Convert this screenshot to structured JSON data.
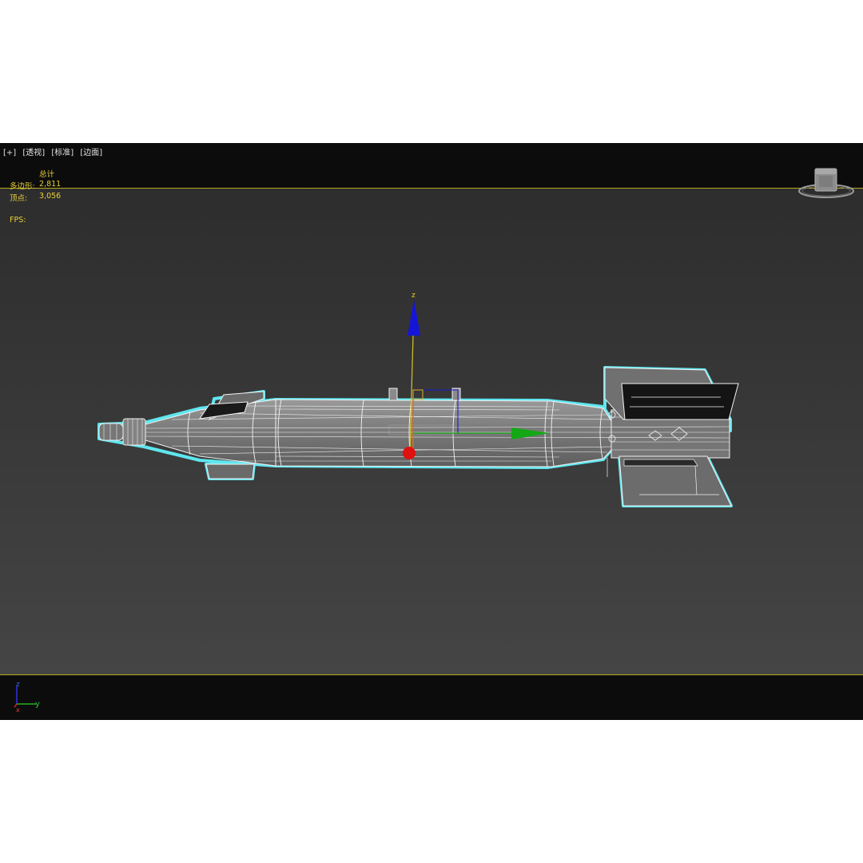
{
  "viewport": {
    "labels": [
      "[+]",
      "[透视]",
      "[标准]",
      "[边面]"
    ]
  },
  "stats": {
    "total_label": "总计",
    "polygons_label": "多边形:",
    "polygons_value": "2,811",
    "vertices_label": "顶点:",
    "vertices_value": "3,056",
    "fps_label": "FPS:"
  },
  "gizmo": {
    "z_label": "z"
  },
  "axis_tripod": {
    "z": "z",
    "y": "y",
    "x": "x"
  },
  "colors": {
    "stat_text": "#e8cf3a",
    "selection_outline": "#5fe6ef",
    "gizmo_z": "#1515d8",
    "gizmo_y": "#14a814",
    "gizmo_x": "#e01010",
    "grid_line": "#b8a820"
  },
  "icons": {
    "viewcube": "viewcube-icon"
  }
}
